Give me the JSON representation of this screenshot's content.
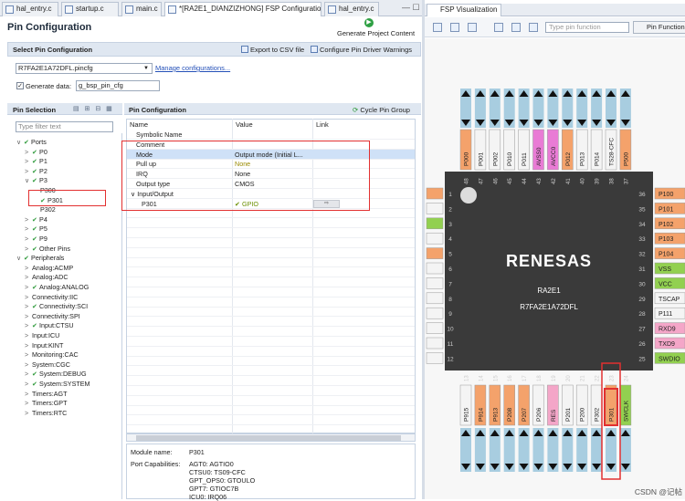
{
  "editor_tabs": [
    {
      "label": "hal_entry.c",
      "active": false
    },
    {
      "label": "startup.c",
      "active": false
    },
    {
      "label": "main.c",
      "active": false
    },
    {
      "label": "*[RA2E1_DIANZIZHONG] FSP Configuration",
      "active": true
    },
    {
      "label": "hal_entry.c",
      "active": false
    }
  ],
  "window_buttons": "— ☐",
  "header": {
    "title": "Pin Configuration",
    "generate_label": "Generate Project Content"
  },
  "select_section": {
    "title": "Select Pin Configuration",
    "export_label": "Export to CSV file",
    "warnings_label": "Configure Pin Driver Warnings",
    "config_file": "R7FA2E1A72DFL.pincfg",
    "manage_link": "Manage configurations...",
    "generate_data_label": "Generate data:",
    "generate_data_value": "g_bsp_pin_cfg",
    "generate_data_checked": true
  },
  "pin_selection": {
    "title": "Pin Selection",
    "filter_placeholder": "Type filter text",
    "tree": [
      {
        "label": "Ports",
        "indent": 0,
        "caret": "∨",
        "check": true
      },
      {
        "label": "P0",
        "indent": 1,
        "caret": ">",
        "check": true
      },
      {
        "label": "P1",
        "indent": 1,
        "caret": ">",
        "check": true
      },
      {
        "label": "P2",
        "indent": 1,
        "caret": ">",
        "check": true
      },
      {
        "label": "P3",
        "indent": 1,
        "caret": "∨",
        "check": true
      },
      {
        "label": "P300",
        "indent": 2,
        "caret": "",
        "check": false
      },
      {
        "label": "P301",
        "indent": 2,
        "caret": "",
        "check": true,
        "selected": true
      },
      {
        "label": "P302",
        "indent": 2,
        "caret": "",
        "check": false
      },
      {
        "label": "P4",
        "indent": 1,
        "caret": ">",
        "check": true
      },
      {
        "label": "P5",
        "indent": 1,
        "caret": ">",
        "check": true
      },
      {
        "label": "P9",
        "indent": 1,
        "caret": ">",
        "check": true
      },
      {
        "label": "Other Pins",
        "indent": 1,
        "caret": ">",
        "check": true
      },
      {
        "label": "Peripherals",
        "indent": 0,
        "caret": "∨",
        "check": true
      },
      {
        "label": "Analog:ACMP",
        "indent": 1,
        "caret": ">",
        "check": false
      },
      {
        "label": "Analog:ADC",
        "indent": 1,
        "caret": ">",
        "check": false
      },
      {
        "label": "Analog:ANALOG",
        "indent": 1,
        "caret": ">",
        "check": true
      },
      {
        "label": "Connectivity:IIC",
        "indent": 1,
        "caret": ">",
        "check": false
      },
      {
        "label": "Connectivity:SCI",
        "indent": 1,
        "caret": ">",
        "check": true
      },
      {
        "label": "Connectivity:SPI",
        "indent": 1,
        "caret": ">",
        "check": false
      },
      {
        "label": "Input:CTSU",
        "indent": 1,
        "caret": ">",
        "check": true
      },
      {
        "label": "Input:ICU",
        "indent": 1,
        "caret": ">",
        "check": false
      },
      {
        "label": "Input:KINT",
        "indent": 1,
        "caret": ">",
        "check": false
      },
      {
        "label": "Monitoring:CAC",
        "indent": 1,
        "caret": ">",
        "check": false
      },
      {
        "label": "System:CGC",
        "indent": 1,
        "caret": ">",
        "check": false
      },
      {
        "label": "System:DEBUG",
        "indent": 1,
        "caret": ">",
        "check": true
      },
      {
        "label": "System:SYSTEM",
        "indent": 1,
        "caret": ">",
        "check": true
      },
      {
        "label": "Timers:AGT",
        "indent": 1,
        "caret": ">",
        "check": false
      },
      {
        "label": "Timers:GPT",
        "indent": 1,
        "caret": ">",
        "check": false
      },
      {
        "label": "Timers:RTC",
        "indent": 1,
        "caret": ">",
        "check": false
      }
    ]
  },
  "pin_config": {
    "title": "Pin Configuration",
    "cycle_label": "Cycle Pin Group",
    "columns": [
      "Name",
      "Value",
      "Link"
    ],
    "rows": [
      {
        "name": "Symbolic Name",
        "value": "",
        "indent": 1
      },
      {
        "name": "Comment",
        "value": "",
        "indent": 1
      },
      {
        "name": "Mode",
        "value": "Output mode (Initial L...",
        "indent": 1,
        "highlight": true
      },
      {
        "name": "Pull up",
        "value": "None",
        "indent": 1,
        "value_color": "#9a8a00"
      },
      {
        "name": "IRQ",
        "value": "None",
        "indent": 1
      },
      {
        "name": "Output type",
        "value": "CMOS",
        "indent": 1
      },
      {
        "name": "∨ Input/Output",
        "value": "",
        "indent": 0
      },
      {
        "name": "P301",
        "value": "✔ GPIO",
        "indent": 2,
        "value_color": "#6a8f00",
        "link": "⇨"
      }
    ],
    "details": {
      "module_label": "Module name:",
      "module_value": "P301",
      "caps_label": "Port Capabilities:",
      "caps": [
        "AGT0: AGTIO0",
        "CTSU0: TS09-CFC",
        "GPT_OPS0: GTOULO",
        "GPT7: GTIOC7B",
        "ICU0: IRQ06"
      ]
    }
  },
  "viz": {
    "tab_label": "FSP Visualization",
    "search_placeholder": "Type pin function",
    "pin_function_label": "Pin Function",
    "chip_brand": "RENESAS",
    "chip_name": "RA2E1",
    "chip_part": "R7FA2E1A72DFL",
    "top_pins": [
      {
        "label": "P000",
        "num": "48",
        "color": "#f4a26b"
      },
      {
        "label": "P001",
        "num": "47",
        "color": "#f4f4f4"
      },
      {
        "label": "P002",
        "num": "46",
        "color": "#f4f4f4"
      },
      {
        "label": "P010",
        "num": "45",
        "color": "#f4f4f4"
      },
      {
        "label": "P011",
        "num": "44",
        "color": "#f4f4f4"
      },
      {
        "label": "AVSS0",
        "num": "43",
        "color": "#e97bd5"
      },
      {
        "label": "AVCC0",
        "num": "42",
        "color": "#e97bd5"
      },
      {
        "label": "P012",
        "num": "41",
        "color": "#f4a26b"
      },
      {
        "label": "P013",
        "num": "40",
        "color": "#f4f4f4"
      },
      {
        "label": "P014",
        "num": "39",
        "color": "#f4f4f4"
      },
      {
        "label": "TS28-CFC",
        "num": "38",
        "color": "#f4f4f4"
      },
      {
        "label": "P500",
        "num": "37",
        "color": "#f4a26b"
      }
    ],
    "right_pins": [
      {
        "label": "P100",
        "num": "36",
        "color": "#f4a26b"
      },
      {
        "label": "P101",
        "num": "35",
        "color": "#f4a26b"
      },
      {
        "label": "P102",
        "num": "34",
        "color": "#f4a26b"
      },
      {
        "label": "P103",
        "num": "33",
        "color": "#f4a26b"
      },
      {
        "label": "P104",
        "num": "32",
        "color": "#f4a26b"
      },
      {
        "label": "VSS",
        "num": "31",
        "color": "#92d050"
      },
      {
        "label": "VCC",
        "num": "30",
        "color": "#92d050"
      },
      {
        "label": "TSCAP",
        "num": "29",
        "color": "#f4f4f4"
      },
      {
        "label": "P111",
        "num": "28",
        "color": "#f4f4f4"
      },
      {
        "label": "RXD9",
        "num": "27",
        "color": "#f4a6c8"
      },
      {
        "label": "TXD9",
        "num": "26",
        "color": "#f4a6c8"
      },
      {
        "label": "SWDIO",
        "num": "25",
        "color": "#92d050"
      }
    ],
    "bottom_pins": [
      {
        "label": "P915",
        "num": "13",
        "color": "#f4f4f4"
      },
      {
        "label": "P914",
        "num": "14",
        "color": "#f4a26b"
      },
      {
        "label": "P913",
        "num": "15",
        "color": "#f4a26b"
      },
      {
        "label": "P208",
        "num": "16",
        "color": "#f4a26b"
      },
      {
        "label": "P207",
        "num": "17",
        "color": "#f4a26b"
      },
      {
        "label": "P206",
        "num": "18",
        "color": "#f4f4f4"
      },
      {
        "label": "RES",
        "num": "19",
        "color": "#f4a6c8"
      },
      {
        "label": "P201",
        "num": "20",
        "color": "#f4f4f4"
      },
      {
        "label": "P200",
        "num": "21",
        "color": "#f4f4f4"
      },
      {
        "label": "P302",
        "num": "22",
        "color": "#f4f4f4"
      },
      {
        "label": "P301",
        "num": "23",
        "color": "#f4a26b"
      },
      {
        "label": "SWCLK",
        "num": "24",
        "color": "#92d050"
      }
    ],
    "left_nums": [
      "1",
      "2",
      "3",
      "4",
      "5",
      "6",
      "7",
      "8",
      "9",
      "10",
      "11",
      "12"
    ],
    "left_colors": [
      "#f4a26b",
      "#f4f4f4",
      "#92d050",
      "#f4f4f4",
      "#f4a26b",
      "#f4f4f4",
      "#f4f4f4",
      "#f4f4f4",
      "#f4f4f4",
      "#f4f4f4",
      "#f4f4f4",
      "#f4f4f4"
    ]
  },
  "watermark": "CSDN @记帖"
}
